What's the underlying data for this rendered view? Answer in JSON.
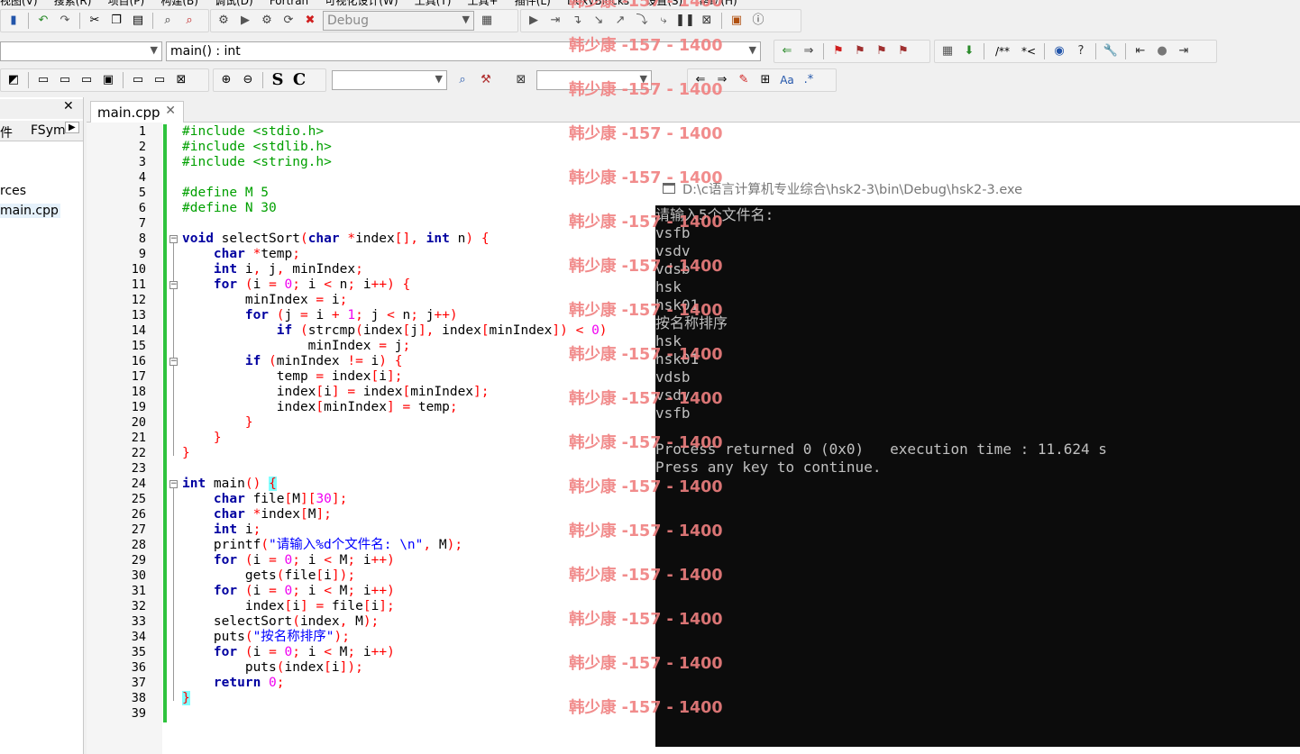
{
  "menubar": {
    "items": [
      "视图(V)",
      "搜索(R)",
      "项目(P)",
      "构建(B)",
      "调试(D)",
      "Fortran",
      "可视化设计(W)",
      "工具(T)",
      "工具+",
      "插件(L)",
      "DoxyBlocks",
      "设置(S)",
      "帮助(H)"
    ]
  },
  "toolbar1": {
    "build_target": "Debug"
  },
  "toolbar2": {
    "function_scope": "main() : int"
  },
  "toolbar3": {
    "s_label": "S",
    "c_label": "C",
    "search_value": "",
    "replace_value": ""
  },
  "left_panel": {
    "tabs": [
      "件",
      "FSym"
    ],
    "items": [
      "rces",
      "main.cpp"
    ]
  },
  "editor": {
    "tab_label": "main.cpp",
    "line_numbers": [
      "1",
      "2",
      "3",
      "4",
      "5",
      "6",
      "7",
      "8",
      "9",
      "10",
      "11",
      "12",
      "13",
      "14",
      "15",
      "16",
      "17",
      "18",
      "19",
      "20",
      "21",
      "22",
      "23",
      "24",
      "25",
      "26",
      "27",
      "28",
      "29",
      "30",
      "31",
      "32",
      "33",
      "34",
      "35",
      "36",
      "37",
      "38",
      "39"
    ]
  },
  "console": {
    "title": "D:\\c语言计算机专业综合\\hsk2-3\\bin\\Debug\\hsk2-3.exe",
    "lines": [
      "请输入5个文件名:",
      "vsfb",
      "vsdv",
      "vdsb",
      "hsk",
      "hsk01",
      "按名称排序",
      "hsk",
      "hsk01",
      "vdsb",
      "vsdv",
      "vsfb",
      "",
      "Process returned 0 (0x0)   execution time : 11.624 s",
      "Press any key to continue."
    ]
  },
  "watermark": "韩少康 -157 - 1400"
}
